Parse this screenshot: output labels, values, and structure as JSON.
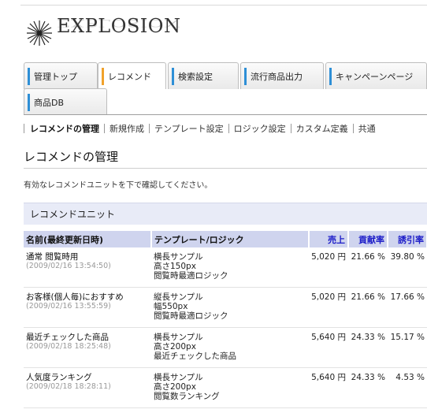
{
  "logo": {
    "text": "EXPLOSION"
  },
  "tabs": [
    {
      "label": "管理トップ",
      "bar_color": "#2e8fd6"
    },
    {
      "label": "レコメンド",
      "bar_color": "#f0a22b",
      "active": true
    },
    {
      "label": "検索設定",
      "bar_color": "#2e8fd6"
    },
    {
      "label": "流行商品出力",
      "bar_color": "#2e8fd6"
    },
    {
      "label": "キャンペーンページ",
      "bar_color": "#2e8fd6"
    },
    {
      "label": "商品DB",
      "bar_color": "#2e8fd6"
    }
  ],
  "subnav": [
    {
      "label": "レコメンドの管理",
      "current": true
    },
    {
      "label": "新規作成"
    },
    {
      "label": "テンプレート設定"
    },
    {
      "label": "ロジック設定"
    },
    {
      "label": "カスタム定義"
    },
    {
      "label": "共通"
    }
  ],
  "page": {
    "title": "レコメンドの管理",
    "description": "有効なレコメンドユニットを下で確認してください。"
  },
  "unit_panel": {
    "heading": "レコメンドユニット",
    "columns": {
      "name": "名前(最終更新日時)",
      "template": "テンプレート/ロジック",
      "sales": "売上",
      "contribution": "貢献率",
      "conversion": "誘引率"
    },
    "rows": [
      {
        "name": "通常 閲覧時用",
        "date": "(2009/02/16 13:54:50)",
        "template": [
          "横長サンプル",
          "高さ150px",
          "閲覧時最適ロジック"
        ],
        "sales": "5,020 円",
        "contribution": "21.66 %",
        "conversion": "39.80 %"
      },
      {
        "name": "お客様(個人毎)におすすめ",
        "date": "(2009/02/16 13:55:59)",
        "template": [
          "縦長サンプル",
          "幅550px",
          "閲覧時最適ロジック"
        ],
        "sales": "5,020 円",
        "contribution": "21.66 %",
        "conversion": "17.66 %"
      },
      {
        "name": "最近チェックした商品",
        "date": "(2009/02/18 18:25:48)",
        "template": [
          "横長サンプル",
          "高さ200px",
          "最近チェックした商品"
        ],
        "sales": "5,640 円",
        "contribution": "24.33 %",
        "conversion": "15.17 %"
      },
      {
        "name": "人気度ランキング",
        "date": "(2009/02/18 18:28:11)",
        "template": [
          "横長サンプル",
          "高さ200px",
          "閲覧数ランキング"
        ],
        "sales": "5,640 円",
        "contribution": "24.33 %",
        "conversion": "4.53 %"
      }
    ]
  }
}
